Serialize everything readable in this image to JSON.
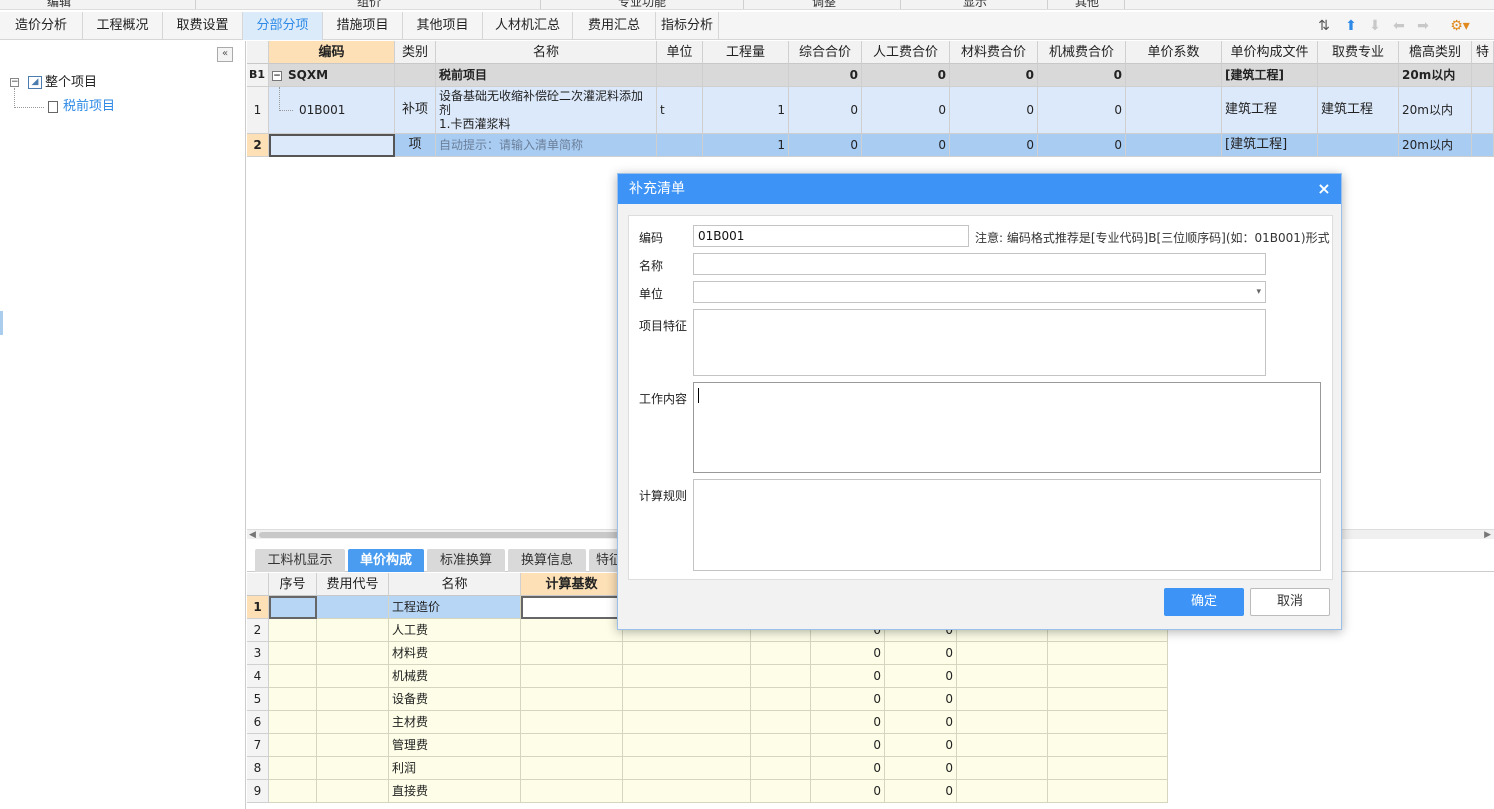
{
  "ribbon_groups": [
    "编辑",
    "组价",
    "专业功能",
    "调整",
    "显示",
    "其他"
  ],
  "tabs": [
    {
      "label": "造价分析"
    },
    {
      "label": "工程概况"
    },
    {
      "label": "取费设置"
    },
    {
      "label": "分部分项"
    },
    {
      "label": "措施项目"
    },
    {
      "label": "其他项目"
    },
    {
      "label": "人材机汇总"
    },
    {
      "label": "费用汇总"
    },
    {
      "label": "指标分析"
    }
  ],
  "toolbar_icons": [
    "sort-icon",
    "move-up-icon",
    "move-down-icon",
    "move-left-icon",
    "move-right-icon",
    "settings-icon"
  ],
  "tree": {
    "collapse_label": "«",
    "root": {
      "label": "整个项目",
      "toggle": "−"
    },
    "child": {
      "label": "税前项目"
    }
  },
  "grid": {
    "headers": [
      "编码",
      "类别",
      "名称",
      "单位",
      "工程量",
      "综合合价",
      "人工费合价",
      "材料费合价",
      "机械费合价",
      "单价系数",
      "单价构成文件",
      "取费专业",
      "檐高类别",
      "特"
    ],
    "rows": [
      {
        "rownum": "B1",
        "code": "SQXM",
        "type": "",
        "name": "税前项目",
        "name2": "",
        "name3": "",
        "unit": "",
        "qty": "",
        "total": "0",
        "labor": "0",
        "material": "0",
        "machine": "0",
        "coef": "",
        "file": "[建筑工程]",
        "profession": "",
        "height": "20m以内"
      },
      {
        "rownum": "1",
        "code": "01B001",
        "type": "补项",
        "name": "设备基础无收缩补偿砼二次灌泥料添加",
        "name2": "剂",
        "name3": "1.卡西灌浆料",
        "unit": "t",
        "qty": "1",
        "total": "0",
        "labor": "0",
        "material": "0",
        "machine": "0",
        "coef": "",
        "file": "建筑工程",
        "profession": "建筑工程",
        "height": "20m以内"
      },
      {
        "rownum": "2",
        "code": "",
        "type": "项",
        "name": "自动提示：请输入清单简称",
        "name2": "",
        "name3": "",
        "unit": "",
        "qty": "1",
        "total": "0",
        "labor": "0",
        "material": "0",
        "machine": "0",
        "coef": "",
        "file": "[建筑工程]",
        "profession": "",
        "height": "20m以内"
      }
    ]
  },
  "bottom": {
    "tabs": [
      "工料机显示",
      "单价构成",
      "标准换算",
      "换算信息",
      "特征"
    ],
    "headers": [
      "序号",
      "费用代号",
      "名称",
      "计算基数"
    ],
    "rows": [
      {
        "n": "1",
        "name": "工程造价",
        "a": "",
        "b": ""
      },
      {
        "n": "2",
        "name": "人工费",
        "a": "0",
        "b": "0"
      },
      {
        "n": "3",
        "name": "材料费",
        "a": "0",
        "b": "0"
      },
      {
        "n": "4",
        "name": "机械费",
        "a": "0",
        "b": "0"
      },
      {
        "n": "5",
        "name": "设备费",
        "a": "0",
        "b": "0"
      },
      {
        "n": "6",
        "name": "主材费",
        "a": "0",
        "b": "0"
      },
      {
        "n": "7",
        "name": "管理费",
        "a": "0",
        "b": "0"
      },
      {
        "n": "8",
        "name": "利润",
        "a": "0",
        "b": "0"
      },
      {
        "n": "9",
        "name": "直接费",
        "a": "0",
        "b": "0"
      }
    ]
  },
  "dialog": {
    "title": "补充清单",
    "close": "×",
    "code_label": "编码",
    "code_value": "01B001",
    "note": "注意: 编码格式推荐是[专业代码]B[三位顺序码](如：01B001)形式",
    "name_label": "名称",
    "unit_label": "单位",
    "unit_arrow": "▾",
    "feature_label": "项目特征",
    "work_label": "工作内容",
    "rule_label": "计算规则",
    "ok": "确定",
    "cancel": "取消"
  }
}
